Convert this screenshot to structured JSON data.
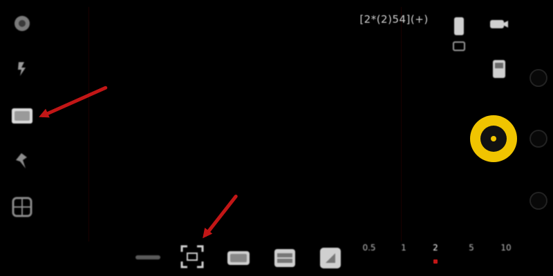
{
  "status": {
    "resolution_text": "[2*(2)54](+)"
  },
  "left_toolbar": {
    "items": [
      {
        "icon": "settings-icon"
      },
      {
        "icon": "flash-icon"
      },
      {
        "icon": "gallery-icon"
      },
      {
        "icon": "focus-icon"
      },
      {
        "icon": "grid-icon"
      }
    ]
  },
  "right_toolbar": {
    "items": [
      {
        "icon": "battery-icon"
      },
      {
        "icon": "camera-icon"
      },
      {
        "icon": "sd-card-icon"
      }
    ]
  },
  "bottom_toolbar": {
    "zoom_levels": [
      "0.5",
      "1",
      "2",
      "5",
      "10"
    ],
    "active_zoom_index": 2
  },
  "colors": {
    "accent": "#f0c400",
    "annotation": "#c21616"
  }
}
